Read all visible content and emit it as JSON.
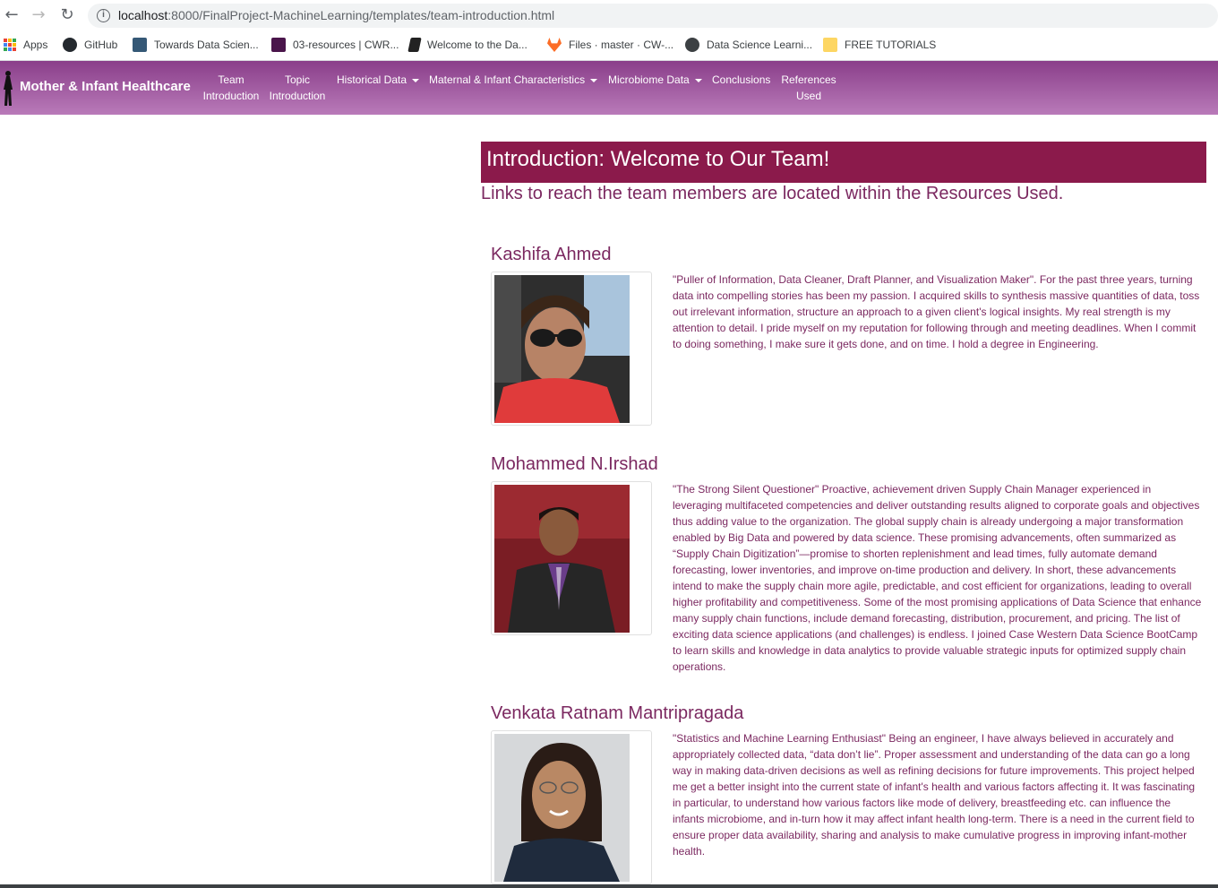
{
  "browser": {
    "url_host": "localhost",
    "url_path": ":8000/FinalProject-MachineLearning/templates/team-introduction.html",
    "bookmarks": [
      {
        "label": "Apps",
        "icon": "apps-grid-icon"
      },
      {
        "label": "GitHub",
        "icon": "github-icon"
      },
      {
        "label": "Towards Data Scien...",
        "icon": "tds-icon"
      },
      {
        "label": "03-resources | CWR...",
        "icon": "slack-icon"
      },
      {
        "label": "Welcome to the Da...",
        "icon": "book-icon"
      },
      {
        "label": "Files · master · CW-...",
        "icon": "gitlab-icon"
      },
      {
        "label": "Data Science Learni...",
        "icon": "ds-icon"
      },
      {
        "label": "FREE TUTORIALS",
        "icon": "folder-icon"
      }
    ]
  },
  "navbar": {
    "brand": "Mother & Infant Healthcare",
    "items": [
      {
        "line1": "Team",
        "line2": "Introduction"
      },
      {
        "line1": "Topic",
        "line2": "Introduction"
      },
      {
        "line1": "Historical Data",
        "dropdown": true
      },
      {
        "line1": "Maternal & Infant Characteristics",
        "dropdown": true
      },
      {
        "line1": "Microbiome Data",
        "dropdown": true
      },
      {
        "line1": "Conclusions"
      },
      {
        "line1": "References",
        "line2": "Used"
      }
    ]
  },
  "main": {
    "title": "Introduction: Welcome to Our Team!",
    "subtitle": "Links to reach the team members are located within the Resources Used.",
    "members": [
      {
        "name": "Kashifa Ahmed",
        "bio": "\"Puller of Information, Data Cleaner, Draft Planner, and Visualization Maker\". For the past three years, turning data into compelling stories has been my passion. I acquired skills to synthesis massive quantities of data, toss out irrelevant information, structure an approach to a given client's logical insights. My real strength is my attention to detail. I pride myself on my reputation for following through and meeting deadlines. When I commit to doing something, I make sure it gets done, and on time. I hold a degree in Engineering."
      },
      {
        "name": "Mohammed N.Irshad",
        "bio": "\"The Strong Silent Questioner\" Proactive, achievement driven Supply Chain Manager experienced in leveraging multifaceted competencies and deliver outstanding results aligned to corporate goals and objectives thus adding value to the organization. The global supply chain is already undergoing a major transformation enabled by Big Data and powered by data science. These promising advancements, often summarized as “Supply Chain Digitization”—promise to shorten replenishment and lead times, fully automate demand forecasting, lower inventories, and improve on-time production and delivery. In short, these advancements intend to make the supply chain more agile, predictable, and cost efficient for organizations, leading to overall higher profitability and competitiveness. Some of the most promising applications of Data Science that enhance many supply chain functions, include demand forecasting, distribution, procurement, and pricing. The list of exciting data science applications (and challenges) is endless. I joined Case Western Data Science BootCamp to learn skills and knowledge in data analytics to provide valuable strategic inputs for optimized supply chain operations."
      },
      {
        "name": "Venkata Ratnam Mantripragada",
        "bio": "\"Statistics and Machine Learning Enthusiast\" Being an engineer, I have always believed in accurately and appropriately collected data, “data don’t lie”. Proper assessment and understanding of the data can go a long way in making data-driven decisions as well as refining decisions for future improvements. This project helped me get a better insight into the current state of infant's health and various factors affecting it. It was fascinating in particular, to understand how various factors like mode of delivery, breastfeeding etc. can influence the infants microbiome, and in-turn how it may affect infant health long-term. There is a need in the current field to ensure proper data availability, sharing and analysis to make cumulative progress in improving infant-mother health."
      }
    ]
  }
}
